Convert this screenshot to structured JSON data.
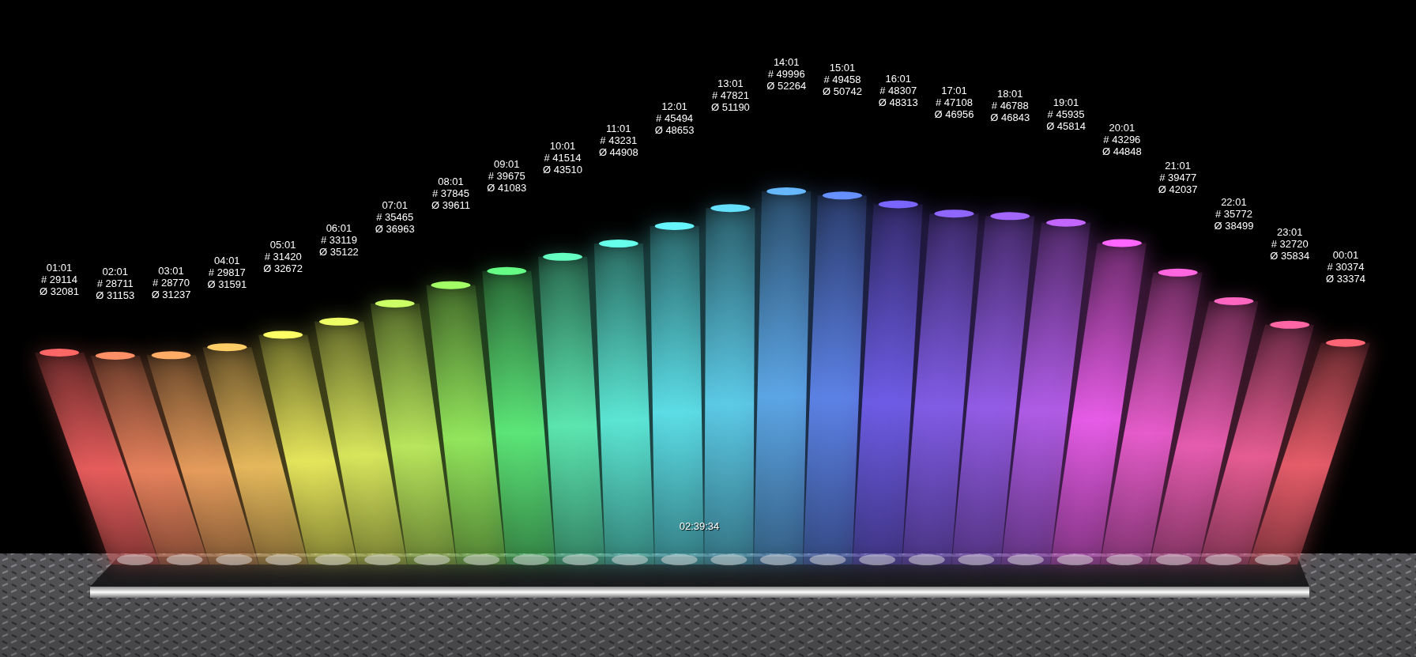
{
  "bars": [
    {
      "time": "01:01",
      "count": "# 29114",
      "average": "Ø 32081",
      "color": "#ff6666"
    },
    {
      "time": "02:01",
      "count": "# 28711",
      "average": "Ø 31153",
      "color": "#ff8f66"
    },
    {
      "time": "03:01",
      "count": "# 28770",
      "average": "Ø 31237",
      "color": "#ffad66"
    },
    {
      "time": "04:01",
      "count": "# 29817",
      "average": "Ø 31591",
      "color": "#ffcc66"
    },
    {
      "time": "05:01",
      "count": "# 31420",
      "average": "Ø 32672",
      "color": "#ffff66"
    },
    {
      "time": "06:01",
      "count": "# 33119",
      "average": "Ø 35122",
      "color": "#efff66"
    },
    {
      "time": "07:01",
      "count": "# 35465",
      "average": "Ø 36963",
      "color": "#ccff66"
    },
    {
      "time": "08:01",
      "count": "# 37845",
      "average": "Ø 39611",
      "color": "#a3ff66"
    },
    {
      "time": "09:01",
      "count": "# 39675",
      "average": "Ø 41083",
      "color": "#66ff85"
    },
    {
      "time": "10:01",
      "count": "# 41514",
      "average": "Ø 43510",
      "color": "#66ffc2"
    },
    {
      "time": "11:01",
      "count": "# 43231",
      "average": "Ø 44908",
      "color": "#66ffeb"
    },
    {
      "time": "12:01",
      "count": "# 45494",
      "average": "Ø 48653",
      "color": "#66f5ff"
    },
    {
      "time": "13:01",
      "count": "# 47821",
      "average": "Ø 51190",
      "color": "#66e0ff"
    },
    {
      "time": "14:01",
      "count": "# 49996",
      "average": "Ø 52264",
      "color": "#66b8ff"
    },
    {
      "time": "15:01",
      "count": "# 49458",
      "average": "Ø 50742",
      "color": "#6690ff"
    },
    {
      "time": "16:01",
      "count": "# 48307",
      "average": "Ø 48313",
      "color": "#7a66ff"
    },
    {
      "time": "17:01",
      "count": "# 47108",
      "average": "Ø 46956",
      "color": "#8f66ff"
    },
    {
      "time": "18:01",
      "count": "# 46788",
      "average": "Ø 46843",
      "color": "#a366ff"
    },
    {
      "time": "19:01",
      "count": "# 45935",
      "average": "Ø 45814",
      "color": "#c266ff"
    },
    {
      "time": "20:01",
      "count": "# 43296",
      "average": "Ø 44848",
      "color": "#ff66ff"
    },
    {
      "time": "21:01",
      "count": "# 39477",
      "average": "Ø 42037",
      "color": "#ff66e0"
    },
    {
      "time": "22:01",
      "count": "# 35772",
      "average": "Ø 38499",
      "color": "#ff66c2"
    },
    {
      "time": "23:01",
      "count": "# 32720",
      "average": "Ø 35834",
      "color": "#ff66a3"
    },
    {
      "time": "00:01",
      "count": "# 30374",
      "average": "Ø 33374",
      "color": "#ff6675"
    }
  ],
  "clock": "02:39:34"
}
